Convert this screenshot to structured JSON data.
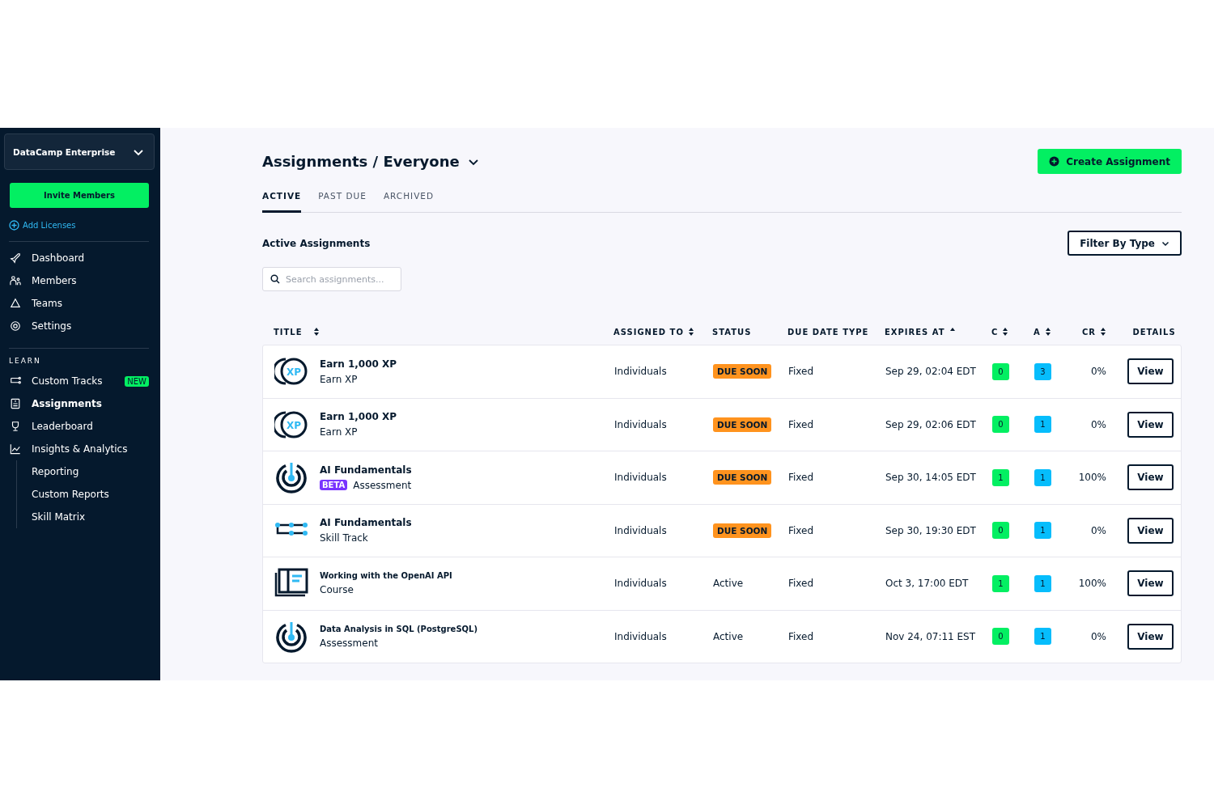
{
  "sidebar": {
    "org": "DataCamp Enterprise",
    "invite_button": "Invite Members",
    "add_licenses": "Add Licenses",
    "items": [
      {
        "label": "Dashboard",
        "selected": false
      },
      {
        "label": "Members",
        "selected": false
      },
      {
        "label": "Teams",
        "selected": false
      },
      {
        "label": "Settings",
        "selected": false
      }
    ],
    "section": "LEARN",
    "learn_items": [
      {
        "label": "Custom Tracks",
        "selected": false,
        "badge": "NEW"
      },
      {
        "label": "Assignments",
        "selected": true
      },
      {
        "label": "Leaderboard",
        "selected": false
      },
      {
        "label": "Insights & Analytics",
        "selected": false,
        "children": [
          {
            "label": "Reporting",
            "selected": false
          },
          {
            "label": "Custom Reports",
            "selected": false
          },
          {
            "label": "Skill Matrix",
            "selected": false
          }
        ]
      }
    ]
  },
  "header": {
    "title": "Assignments / Everyone",
    "create_button": "Create Assignment"
  },
  "tabs": [
    {
      "label": "ACTIVE",
      "selected": true
    },
    {
      "label": "PAST DUE",
      "selected": false
    },
    {
      "label": "ARCHIVED",
      "selected": false
    }
  ],
  "section_title": "Active Assignments",
  "filter_button": "Filter By Type",
  "search": {
    "placeholder": "Search assignments..."
  },
  "table": {
    "columns": [
      {
        "label": "TITLE",
        "kind": "sortable"
      },
      {
        "label": "ASSIGNED TO",
        "kind": "sortable"
      },
      {
        "label": "STATUS",
        "kind": "plain"
      },
      {
        "label": "DUE DATE TYPE",
        "kind": "plain"
      },
      {
        "label": "EXPIRES AT",
        "kind": "sorted"
      },
      {
        "label": "C",
        "kind": "sortable"
      },
      {
        "label": "A",
        "kind": "sortable"
      },
      {
        "label": "CR",
        "kind": "sortable"
      },
      {
        "label": "DETAILS",
        "kind": "plain"
      }
    ],
    "rows": [
      {
        "kind": "xp",
        "icon_text": "XP",
        "title": "Earn 1,000 XP",
        "type": "Earn XP",
        "assigned": "Individuals",
        "status": {
          "text": "DUE SOON",
          "kind": "badge"
        },
        "due_type": "Fixed",
        "expires": "Sep 29, 02:04 EDT",
        "c": "0",
        "a": "3",
        "cr": "0%",
        "action": "View"
      },
      {
        "kind": "xp",
        "icon_text": "XP",
        "title": "Earn 1,000 XP",
        "type": "Earn XP",
        "assigned": "Individuals",
        "status": {
          "text": "DUE SOON",
          "kind": "badge"
        },
        "due_type": "Fixed",
        "expires": "Sep 29, 02:06 EDT",
        "c": "0",
        "a": "1",
        "cr": "0%",
        "action": "View"
      },
      {
        "kind": "assessment",
        "title": "AI Fundamentals",
        "badge": "BETA",
        "type": "Assessment",
        "assigned": "Individuals",
        "status": {
          "text": "DUE SOON",
          "kind": "badge"
        },
        "due_type": "Fixed",
        "expires": "Sep 30, 14:05 EDT",
        "c": "1",
        "a": "1",
        "cr": "100%",
        "action": "View"
      },
      {
        "kind": "track",
        "title": "AI Fundamentals",
        "type": "Skill Track",
        "assigned": "Individuals",
        "status": {
          "text": "DUE SOON",
          "kind": "badge"
        },
        "due_type": "Fixed",
        "expires": "Sep 30, 19:30 EDT",
        "c": "0",
        "a": "1",
        "cr": "0%",
        "action": "View"
      },
      {
        "kind": "course",
        "title": "Working with the OpenAI API",
        "type": "Course",
        "assigned": "Individuals",
        "status": {
          "text": "Active",
          "kind": "text"
        },
        "due_type": "Fixed",
        "expires": "Oct 3, 17:00 EDT",
        "c": "1",
        "a": "1",
        "cr": "100%",
        "action": "View"
      },
      {
        "kind": "assessment",
        "title": "Data Analysis in SQL (PostgreSQL)",
        "type": "Assessment",
        "assigned": "Individuals",
        "status": {
          "text": "Active",
          "kind": "text"
        },
        "due_type": "Fixed",
        "expires": "Nov 24, 07:11 EST",
        "c": "0",
        "a": "1",
        "cr": "0%",
        "action": "View"
      }
    ]
  }
}
